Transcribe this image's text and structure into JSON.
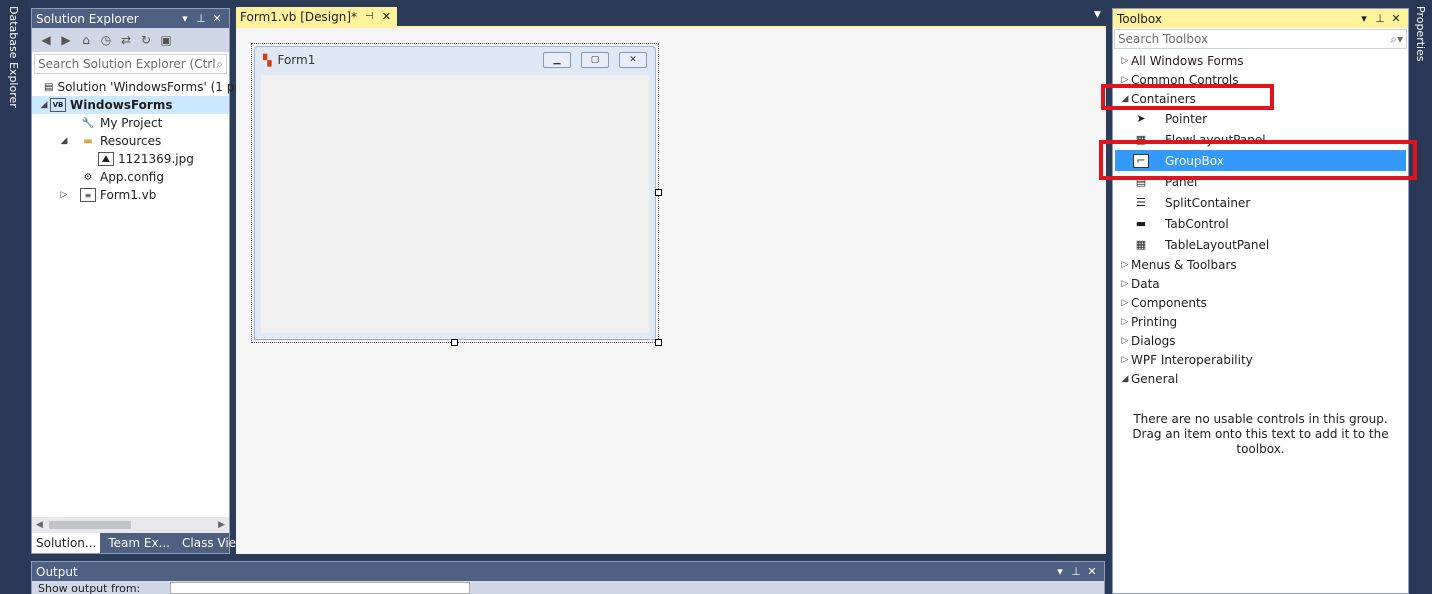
{
  "left_strip": {
    "label": "Database Explorer"
  },
  "right_strip": {
    "label": "Properties"
  },
  "solution_explorer": {
    "title": "Solution Explorer",
    "search_placeholder": "Search Solution Explorer (Ctrl+",
    "tree": [
      {
        "label": "Solution 'WindowsForms' (1 pr",
        "icon": "solution-icon"
      },
      {
        "label": "WindowsForms",
        "icon": "vb-project-icon",
        "selected": true
      },
      {
        "label": "My Project",
        "icon": "wrench-icon"
      },
      {
        "label": "Resources",
        "icon": "folder-icon"
      },
      {
        "label": "1121369.jpg",
        "icon": "image-icon"
      },
      {
        "label": "App.config",
        "icon": "config-icon"
      },
      {
        "label": "Form1.vb",
        "icon": "form-icon"
      }
    ],
    "bottom_tabs": [
      "Solution...",
      "Team Ex...",
      "Class View"
    ]
  },
  "document": {
    "tab_label": "Form1.vb [Design]*",
    "form_title": "Form1"
  },
  "toolbox": {
    "title": "Toolbox",
    "search_placeholder": "Search Toolbox",
    "groups_top": [
      "All Windows Forms",
      "Common Controls",
      "Containers"
    ],
    "container_items": [
      "Pointer",
      "FlowLayoutPanel",
      "GroupBox",
      "Panel",
      "SplitContainer",
      "TabControl",
      "TableLayoutPanel"
    ],
    "selected_item": "GroupBox",
    "groups_bottom": [
      "Menus & Toolbars",
      "Data",
      "Components",
      "Printing",
      "Dialogs",
      "WPF Interoperability",
      "General"
    ],
    "empty_message": "There are no usable controls in this group. Drag an item onto this text to add it to the toolbox."
  },
  "output": {
    "title": "Output",
    "show_output_from": "Show output from:"
  },
  "colors": {
    "background": "#2b3c59",
    "active_header": "#fff29d",
    "selection": "#3399ff",
    "highlight_box": "#e2131d"
  }
}
